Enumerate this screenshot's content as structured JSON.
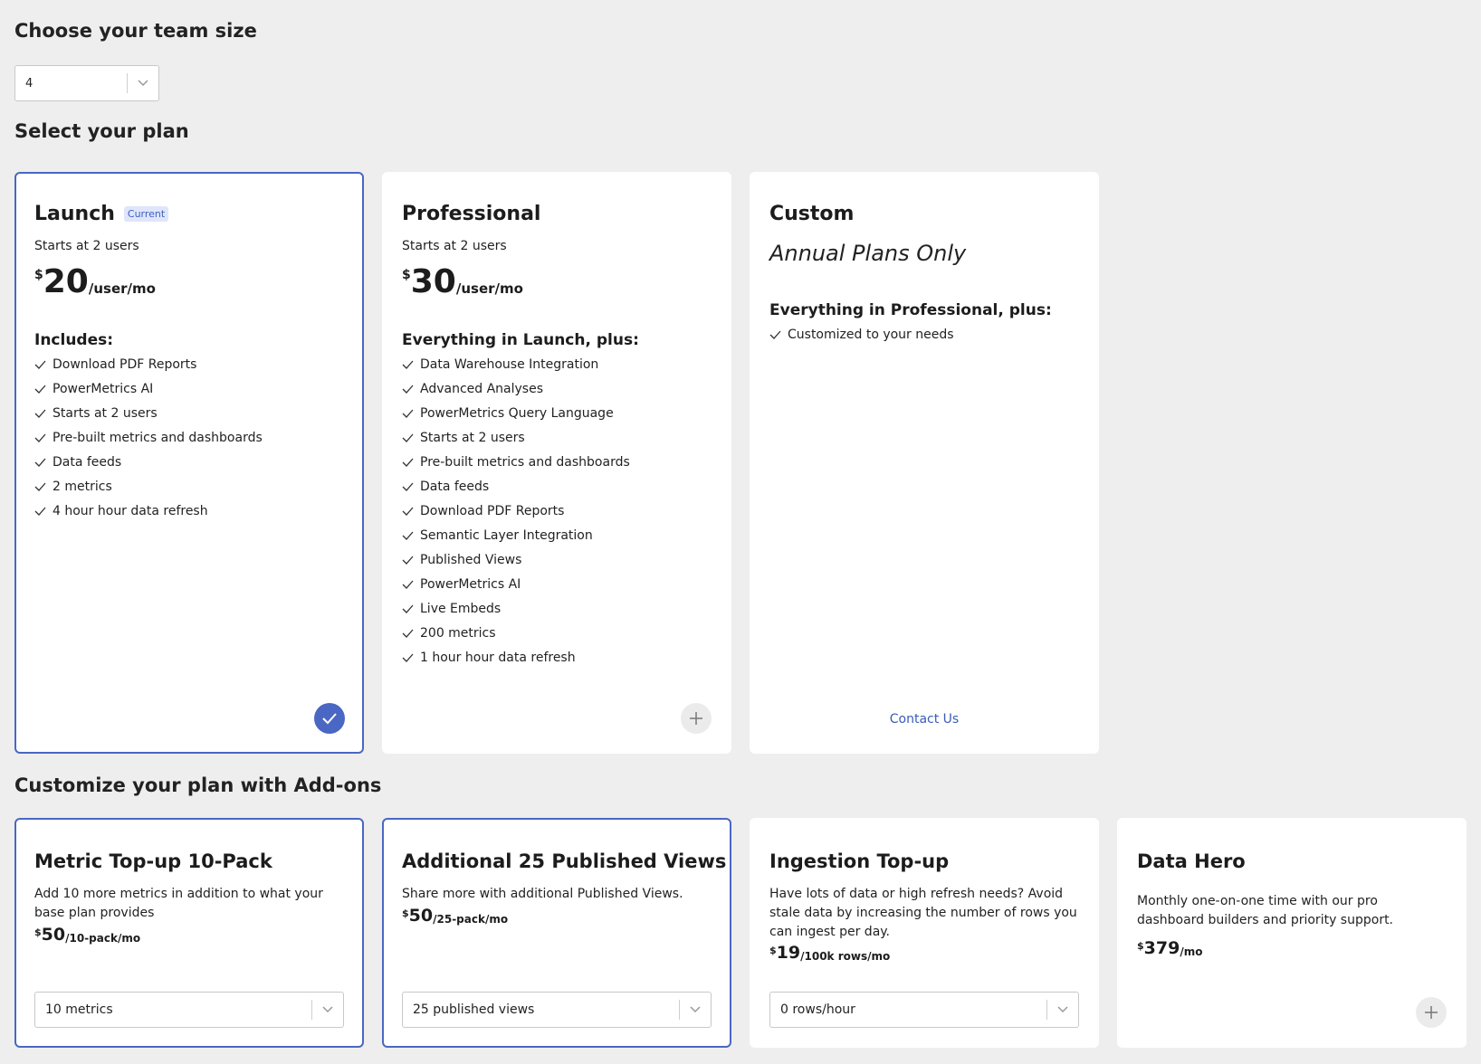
{
  "team": {
    "heading": "Choose your team size",
    "value": "4"
  },
  "plans": {
    "heading": "Select your plan",
    "launch": {
      "name": "Launch",
      "badge": "Current",
      "subtitle": "Starts at 2 users",
      "currency": "$",
      "price": "20",
      "per": "/user/mo",
      "includes_heading": "Includes:",
      "features": [
        "Download PDF Reports",
        "PowerMetrics AI",
        "Starts at 2 users",
        "Pre-built metrics and dashboards",
        "Data feeds",
        "2 metrics",
        "4 hour hour data refresh"
      ]
    },
    "professional": {
      "name": "Professional",
      "subtitle": "Starts at 2 users",
      "currency": "$",
      "price": "30",
      "per": "/user/mo",
      "includes_heading": "Everything in Launch, plus:",
      "features": [
        "Data Warehouse Integration",
        "Advanced Analyses",
        "PowerMetrics Query Language",
        "Starts at 2 users",
        "Pre-built metrics and dashboards",
        "Data feeds",
        "Download PDF Reports",
        "Semantic Layer Integration",
        "Published Views",
        "PowerMetrics AI",
        "Live Embeds",
        "200 metrics",
        "1 hour hour data refresh"
      ]
    },
    "custom": {
      "name": "Custom",
      "subtitle": "Annual Plans Only",
      "includes_heading": "Everything in Professional, plus:",
      "features": [
        "Customized to your needs"
      ],
      "contact": "Contact Us"
    }
  },
  "addons": {
    "heading": "Customize your plan with Add-ons",
    "metric": {
      "name": "Metric Top-up 10-Pack",
      "desc": "Add 10 more metrics in addition to what your base plan provides",
      "currency": "$",
      "price": "50",
      "per": "/10-pack/mo",
      "select_value": "10 metrics"
    },
    "views": {
      "name": "Additional 25 Published Views",
      "desc": "Share more with additional Published Views.",
      "currency": "$",
      "price": "50",
      "per": "/25-pack/mo",
      "select_value": "25 published views"
    },
    "ingestion": {
      "name": "Ingestion Top-up",
      "desc": "Have lots of data or high refresh needs? Avoid stale data by increasing the number of rows you can ingest per day.",
      "currency": "$",
      "price": "19",
      "per": "/100k rows/mo",
      "select_value": "0 rows/hour"
    },
    "hero": {
      "name": "Data Hero",
      "desc": "Monthly one-on-one time with our pro dashboard builders and priority support.",
      "currency": "$",
      "price": "379",
      "per": "/mo"
    }
  },
  "colors": {
    "accent": "#4a67c3",
    "background": "#eeeeee",
    "link": "#3a5bb8"
  },
  "icons": {
    "check": "check-icon",
    "dropdown": "chevron-down-icon",
    "add": "plus-icon",
    "selected": "checkmark-circle-icon"
  }
}
